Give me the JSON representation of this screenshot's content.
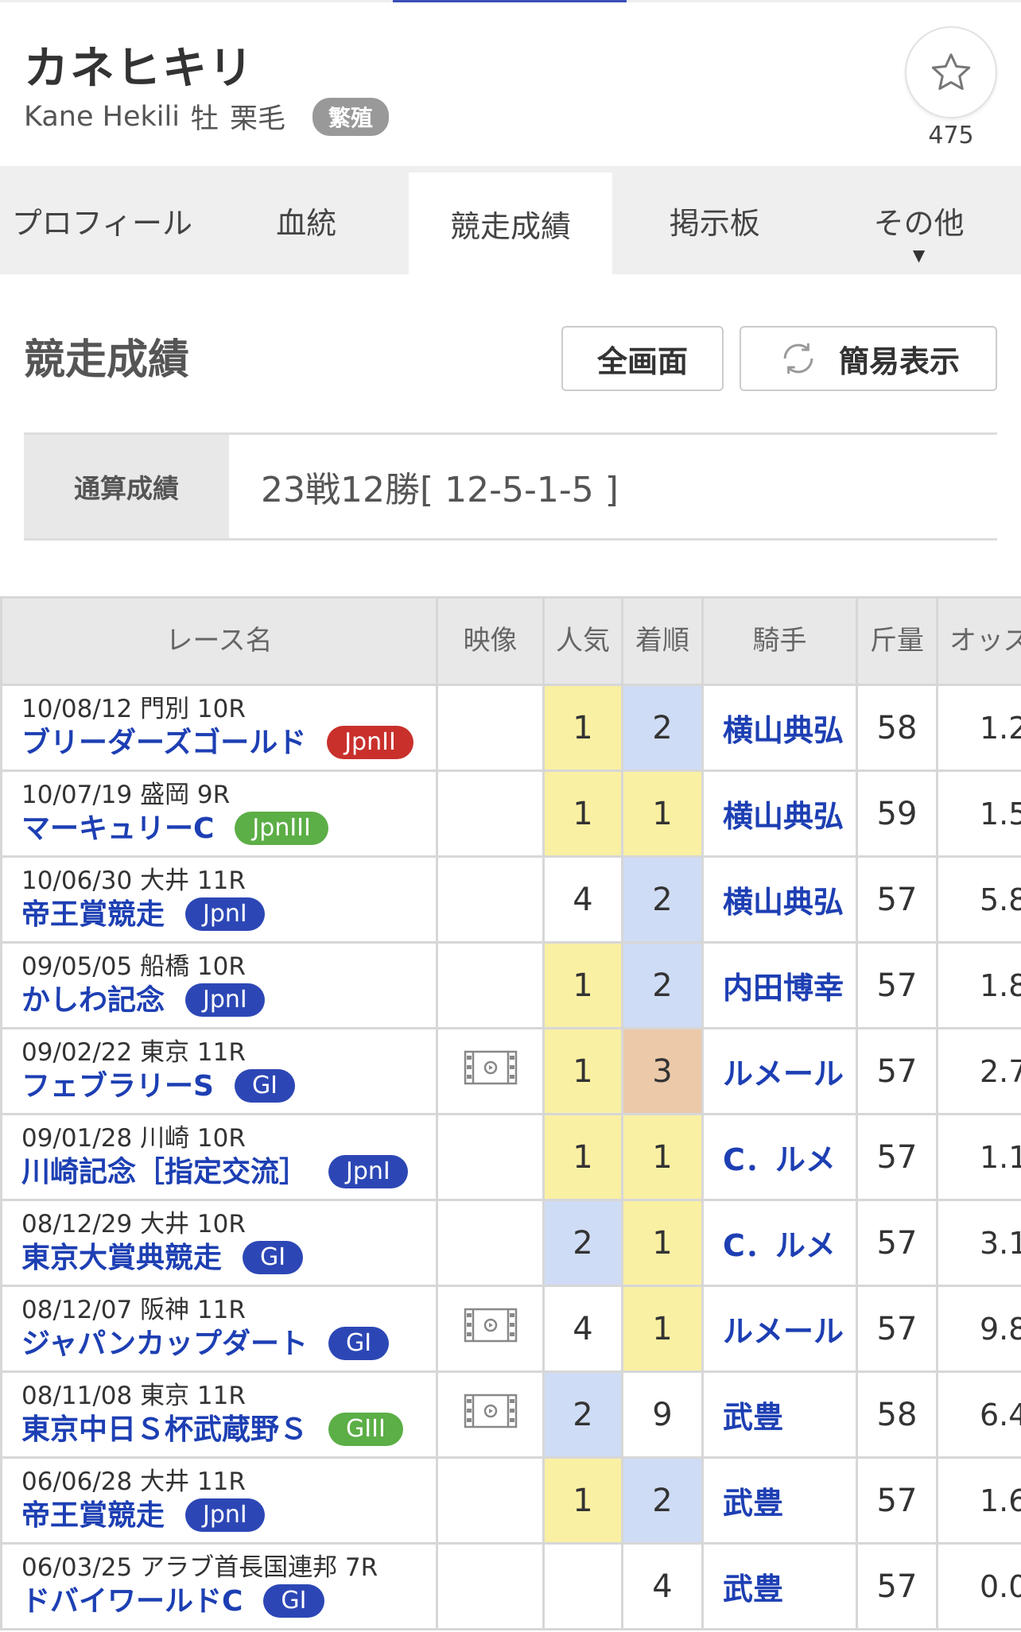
{
  "horse": {
    "name": "カネヒキリ",
    "name_en": "Kane Hekili",
    "sex": "牡",
    "color": "栗毛",
    "status_badge": "繁殖",
    "favorite_count": "475"
  },
  "tabs": [
    {
      "label": "プロフィール",
      "active": false
    },
    {
      "label": "血統",
      "active": false
    },
    {
      "label": "競走成績",
      "active": true
    },
    {
      "label": "掲示板",
      "active": false
    },
    {
      "label": "その他",
      "active": false,
      "caret": "▼"
    }
  ],
  "section": {
    "title": "競走成績",
    "fullscreen_label": "全画面",
    "simple_label": "簡易表示"
  },
  "summary": {
    "label": "通算成績",
    "value": "23戦12勝[ 12-5-1-5 ]"
  },
  "table": {
    "headers": {
      "race": "レース名",
      "video": "映像",
      "popularity": "人気",
      "finish": "着順",
      "jockey": "騎手",
      "weight": "斤量",
      "odds": "オッズ"
    },
    "rows": [
      {
        "date": "10/08/12 門別 10R",
        "race": "ブリーダーズゴールド",
        "grade": "JpnII",
        "grade_color": "red",
        "video": false,
        "pop": "1",
        "pop_bg": "yellow",
        "finish": "2",
        "finish_bg": "blue",
        "jockey": "横山典弘",
        "weight": "58",
        "odds": "1.2"
      },
      {
        "date": "10/07/19 盛岡 9R",
        "race": "マーキュリーC",
        "grade": "JpnIII",
        "grade_color": "green",
        "video": false,
        "pop": "1",
        "pop_bg": "yellow",
        "finish": "1",
        "finish_bg": "yellow",
        "jockey": "横山典弘",
        "weight": "59",
        "odds": "1.5"
      },
      {
        "date": "10/06/30 大井 11R",
        "race": "帝王賞競走",
        "grade": "JpnI",
        "grade_color": "blue",
        "video": false,
        "pop": "4",
        "pop_bg": "none",
        "finish": "2",
        "finish_bg": "blue",
        "jockey": "横山典弘",
        "weight": "57",
        "odds": "5.8"
      },
      {
        "date": "09/05/05 船橋 10R",
        "race": "かしわ記念",
        "grade": "JpnI",
        "grade_color": "blue",
        "video": false,
        "pop": "1",
        "pop_bg": "yellow",
        "finish": "2",
        "finish_bg": "blue",
        "jockey": "内田博幸",
        "weight": "57",
        "odds": "1.8"
      },
      {
        "date": "09/02/22 東京 11R",
        "race": "フェブラリーS",
        "grade": "GI",
        "grade_color": "blue",
        "video": true,
        "pop": "1",
        "pop_bg": "yellow",
        "finish": "3",
        "finish_bg": "orange",
        "jockey": "ルメール",
        "weight": "57",
        "odds": "2.7"
      },
      {
        "date": "09/01/28 川崎 10R",
        "race": "川崎記念［指定交流］",
        "grade": "JpnI",
        "grade_color": "blue",
        "video": false,
        "pop": "1",
        "pop_bg": "yellow",
        "finish": "1",
        "finish_bg": "yellow",
        "jockey": "C．ルメ",
        "weight": "57",
        "odds": "1.1"
      },
      {
        "date": "08/12/29 大井 10R",
        "race": "東京大賞典競走",
        "grade": "GI",
        "grade_color": "blue",
        "video": false,
        "pop": "2",
        "pop_bg": "blue",
        "finish": "1",
        "finish_bg": "yellow",
        "jockey": "C．ルメ",
        "weight": "57",
        "odds": "3.1"
      },
      {
        "date": "08/12/07 阪神 11R",
        "race": "ジャパンカップダート",
        "grade": "GI",
        "grade_color": "blue",
        "video": true,
        "pop": "4",
        "pop_bg": "none",
        "finish": "1",
        "finish_bg": "yellow",
        "jockey": "ルメール",
        "weight": "57",
        "odds": "9.8"
      },
      {
        "date": "08/11/08 東京 11R",
        "race": "東京中日Ｓ杯武蔵野Ｓ",
        "grade": "GIII",
        "grade_color": "green",
        "video": true,
        "pop": "2",
        "pop_bg": "blue",
        "finish": "9",
        "finish_bg": "none",
        "jockey": "武豊",
        "weight": "58",
        "odds": "6.4"
      },
      {
        "date": "06/06/28 大井 11R",
        "race": "帝王賞競走",
        "grade": "JpnI",
        "grade_color": "blue",
        "video": false,
        "pop": "1",
        "pop_bg": "yellow",
        "finish": "2",
        "finish_bg": "blue",
        "jockey": "武豊",
        "weight": "57",
        "odds": "1.6"
      },
      {
        "date": "06/03/25 アラブ首長国連邦 7R",
        "race": "ドバイワールドC",
        "grade": "GI",
        "grade_color": "blue",
        "video": false,
        "pop": "",
        "pop_bg": "none",
        "finish": "4",
        "finish_bg": "none",
        "jockey": "武豊",
        "weight": "57",
        "odds": "0.0"
      }
    ]
  },
  "colors": {
    "accent": "#1d3fb3",
    "grade_red": "#c9302c",
    "grade_green": "#5cae46",
    "grade_blue": "#2c47b5",
    "win_yellow": "#faf0a3",
    "place_blue": "#cfdcf5",
    "show_orange": "#ebc9a9"
  },
  "icons": {
    "favorite": "star-icon",
    "refresh": "refresh-icon",
    "video": "film-icon"
  }
}
